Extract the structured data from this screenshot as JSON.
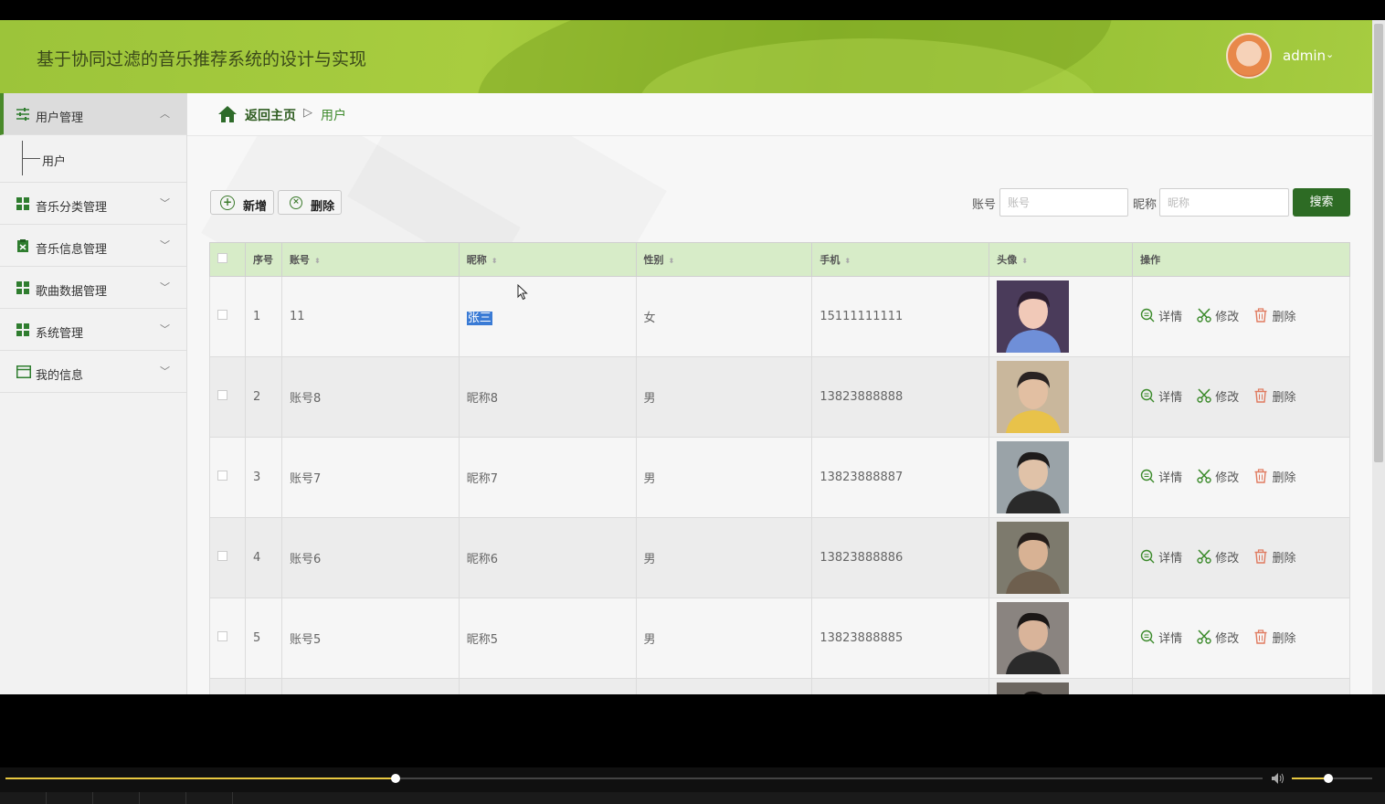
{
  "header": {
    "title": "基于协同过滤的音乐推荐系统的设计与实现",
    "user": "admin",
    "caret": "⌄"
  },
  "sidebar": {
    "items": [
      {
        "label": "用户管理",
        "icon": "sliders-icon",
        "caret": "︿"
      },
      {
        "label": "音乐分类管理",
        "icon": "grid-icon",
        "caret": "﹀"
      },
      {
        "label": "音乐信息管理",
        "icon": "clipboard-icon",
        "caret": "﹀"
      },
      {
        "label": "歌曲数据管理",
        "icon": "grid-icon",
        "caret": "﹀"
      },
      {
        "label": "系统管理",
        "icon": "grid-icon",
        "caret": "﹀"
      },
      {
        "label": "我的信息",
        "icon": "card-icon",
        "caret": "﹀"
      }
    ],
    "sub_items": [
      {
        "label": "用户"
      }
    ]
  },
  "breadcrumb": {
    "home": "返回主页",
    "sep": "▷",
    "current": "用户"
  },
  "toolbar": {
    "add_label": "新增",
    "add_icon": "+",
    "delete_label": "删除",
    "delete_icon": "×"
  },
  "search": {
    "account_label": "账号",
    "account_placeholder": "账号",
    "nickname_label": "昵称",
    "nickname_placeholder": "昵称",
    "button": "搜索"
  },
  "table": {
    "headers": [
      "序号",
      "账号",
      "昵称",
      "性别",
      "手机",
      "头像",
      "操作"
    ],
    "sort_glyph": "⬍",
    "rows": [
      {
        "no": "1",
        "account": "11",
        "nickname": "张三",
        "gender": "女",
        "phone": "15111111111"
      },
      {
        "no": "2",
        "account": "账号8",
        "nickname": "昵称8",
        "gender": "男",
        "phone": "13823888888"
      },
      {
        "no": "3",
        "account": "账号7",
        "nickname": "昵称7",
        "gender": "男",
        "phone": "13823888887"
      },
      {
        "no": "4",
        "account": "账号6",
        "nickname": "昵称6",
        "gender": "男",
        "phone": "13823888886"
      },
      {
        "no": "5",
        "account": "账号5",
        "nickname": "昵称5",
        "gender": "男",
        "phone": "13823888885"
      }
    ],
    "actions": {
      "detail": "详情",
      "edit": "修改",
      "delete": "删除"
    }
  },
  "player": {
    "progress": 0.31,
    "volume": 0.45
  },
  "colors": {
    "accent": "#2d6b24",
    "header": "#9cc43a",
    "table_header": "#d7ecc8",
    "action": "#3b8a2b",
    "delete_action": "#e07a5f"
  }
}
